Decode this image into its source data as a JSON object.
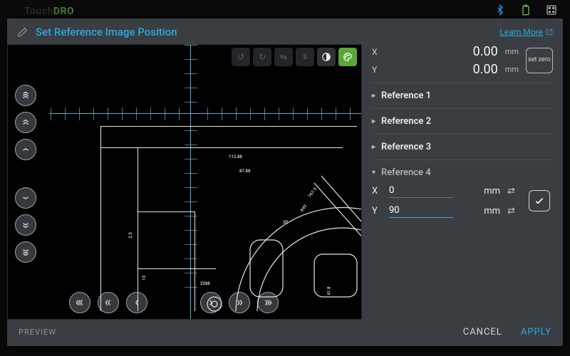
{
  "app": {
    "logo_a": "Touch",
    "logo_b": "DRO"
  },
  "statusbar": {
    "bluetooth_icon": "bluetooth-icon",
    "battery_icon": "battery-icon",
    "dice_icon": "dice-icon"
  },
  "modal": {
    "title": "Set Reference Image Position",
    "learn_more": "Learn More",
    "preview_label": "PREVIEW",
    "cancel": "CANCEL",
    "apply": "APPLY"
  },
  "toolbar": {
    "rotate_ccw": "rotate-ccw",
    "rotate_cw": "rotate-cw",
    "flip_h": "flip-horizontal",
    "flip_v": "flip-vertical",
    "contrast": "contrast",
    "palette": "palette"
  },
  "readout": {
    "x_label": "X",
    "y_label": "Y",
    "x_value": "0.00",
    "y_value": "0.00",
    "unit": "mm",
    "setzero": "set zero"
  },
  "references": [
    {
      "label": "Reference 1",
      "expanded": false
    },
    {
      "label": "Reference 2",
      "expanded": false
    },
    {
      "label": "Reference 3",
      "expanded": false
    },
    {
      "label": "Reference 4",
      "expanded": true,
      "x": "0",
      "y": "90",
      "unit": "mm"
    }
  ],
  "drawing_dims": [
    "112.88",
    "87.88",
    "2.5",
    "13",
    "2288",
    "41.8",
    "2D",
    "767.5",
    "R43"
  ]
}
